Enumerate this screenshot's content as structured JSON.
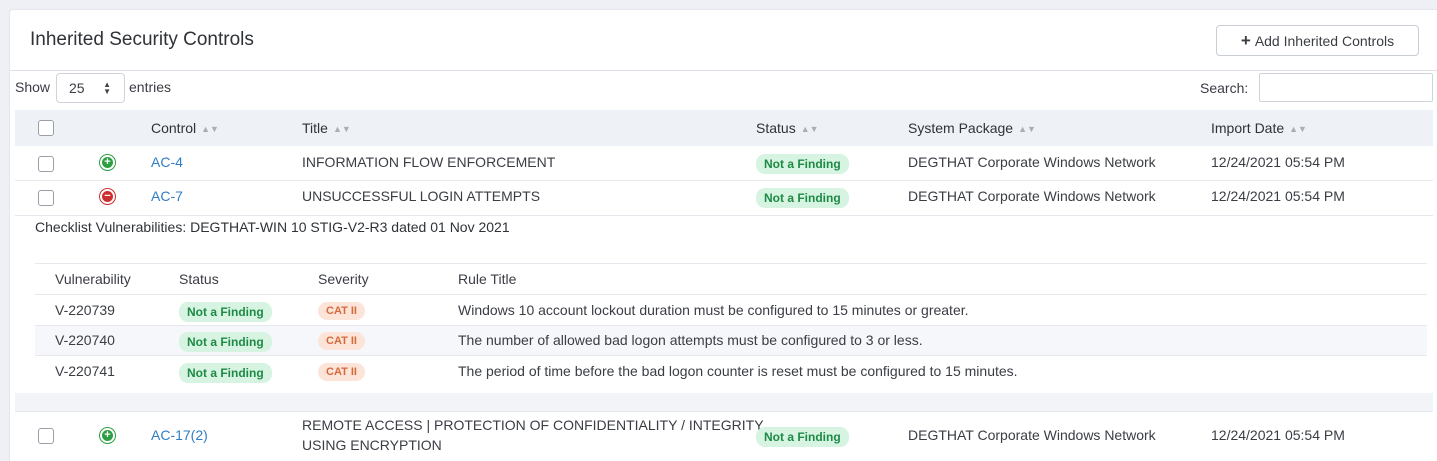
{
  "header": {
    "title": "Inherited Security Controls",
    "add_button": "Add Inherited Controls"
  },
  "toolbar": {
    "show_label": "Show",
    "entries_value": "25",
    "entries_label": "entries",
    "search_label": "Search:",
    "search_value": ""
  },
  "columns": {
    "control": "Control",
    "title": "Title",
    "status": "Status",
    "system_package": "System Package",
    "import_date": "Import Date"
  },
  "rows": [
    {
      "expanded": false,
      "control": "AC-4",
      "title": "INFORMATION FLOW ENFORCEMENT",
      "status": "Not a Finding",
      "system_package": "DEGTHAT Corporate Windows Network",
      "import_date": "12/24/2021 05:54 PM"
    },
    {
      "expanded": true,
      "control": "AC-7",
      "title": "UNSUCCESSFUL LOGIN ATTEMPTS",
      "status": "Not a Finding",
      "system_package": "DEGTHAT Corporate Windows Network",
      "import_date": "12/24/2021 05:54 PM"
    },
    {
      "expanded": false,
      "control": "AC-17(2)",
      "title_line1": "REMOTE ACCESS | PROTECTION OF CONFIDENTIALITY / INTEGRITY",
      "title_line2": "USING ENCRYPTION",
      "status": "Not a Finding",
      "system_package": "DEGTHAT Corporate Windows Network",
      "import_date": "12/24/2021 05:54 PM"
    }
  ],
  "detail": {
    "title": "Checklist Vulnerabilities: DEGTHAT-WIN 10 STIG-V2-R3 dated 01 Nov 2021",
    "columns": {
      "vulnerability": "Vulnerability",
      "status": "Status",
      "severity": "Severity",
      "rule_title": "Rule Title"
    },
    "items": [
      {
        "vulnerability": "V-220739",
        "status": "Not a Finding",
        "severity": "CAT II",
        "rule_title": "Windows 10 account lockout duration must be configured to 15 minutes or greater."
      },
      {
        "vulnerability": "V-220740",
        "status": "Not a Finding",
        "severity": "CAT II",
        "rule_title": "The number of allowed bad logon attempts must be configured to 3 or less."
      },
      {
        "vulnerability": "V-220741",
        "status": "Not a Finding",
        "severity": "CAT II",
        "rule_title": "The period of time before the bad logon counter is reset must be configured to 15 minutes."
      }
    ]
  },
  "icons": {
    "expand": "plus-circle-icon",
    "collapse": "minus-circle-icon",
    "sort": "sort-icon",
    "add": "plus-icon"
  },
  "colors": {
    "link": "#2f7dc4",
    "status_green": "#1f8a45",
    "status_green_bg": "#d6f4e1",
    "severity_orange": "#d36a3c",
    "severity_orange_bg": "#fde4d9",
    "expand_green": "#2e9e44",
    "collapse_red": "#cc2f2f"
  }
}
